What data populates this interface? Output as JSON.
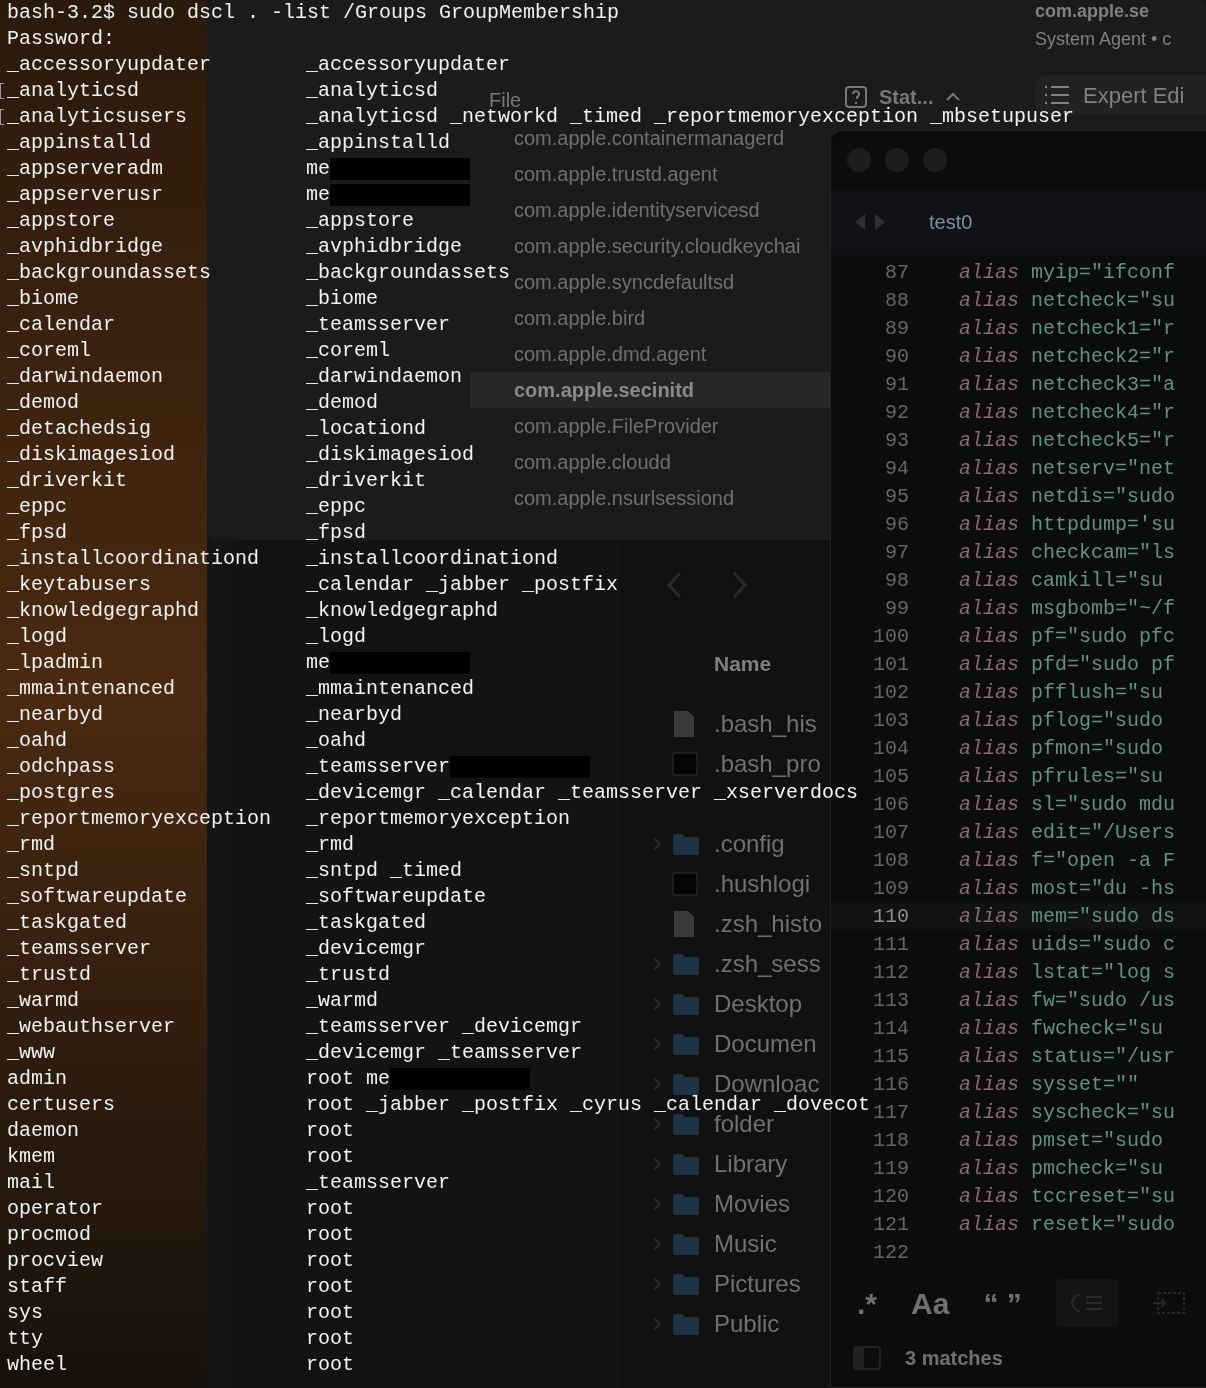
{
  "terminal": {
    "command": "bash-3.2$ sudo dscl . -list /Groups GroupMembership",
    "prompt": "Password:",
    "rows": [
      {
        "group": "_accessoryupdater",
        "members": "_accessoryupdater",
        "marked": false,
        "redacted": false
      },
      {
        "group": "_analyticsd",
        "members": "_analyticsd",
        "marked": true,
        "redacted": false
      },
      {
        "group": "_analyticsusers",
        "members": "_analyticsd _networkd _timed _reportmemoryexception _mbsetupuser",
        "marked": true,
        "redacted": false
      },
      {
        "group": "_appinstalld",
        "members": "_appinstalld",
        "marked": false,
        "redacted": false
      },
      {
        "group": "_appserveradm",
        "members": "me",
        "marked": false,
        "redacted": true
      },
      {
        "group": "_appserverusr",
        "members": "me",
        "marked": false,
        "redacted": true
      },
      {
        "group": "_appstore",
        "members": "_appstore",
        "marked": false,
        "redacted": false
      },
      {
        "group": "_avphidbridge",
        "members": "_avphidbridge",
        "marked": false,
        "redacted": false
      },
      {
        "group": "_backgroundassets",
        "members": "_backgroundassets",
        "marked": false,
        "redacted": false
      },
      {
        "group": "_biome",
        "members": "_biome",
        "marked": false,
        "redacted": false
      },
      {
        "group": "_calendar",
        "members": "_teamsserver",
        "marked": false,
        "redacted": false
      },
      {
        "group": "_coreml",
        "members": "_coreml",
        "marked": false,
        "redacted": false
      },
      {
        "group": "_darwindaemon",
        "members": "_darwindaemon",
        "marked": false,
        "redacted": false
      },
      {
        "group": "_demod",
        "members": "_demod",
        "marked": false,
        "redacted": false
      },
      {
        "group": "_detachedsig",
        "members": "_locationd",
        "marked": false,
        "redacted": false
      },
      {
        "group": "_diskimagesiod",
        "members": "_diskimagesiod",
        "marked": false,
        "redacted": false
      },
      {
        "group": "_driverkit",
        "members": "_driverkit",
        "marked": false,
        "redacted": false
      },
      {
        "group": "_eppc",
        "members": "_eppc",
        "marked": false,
        "redacted": false
      },
      {
        "group": "_fpsd",
        "members": "_fpsd",
        "marked": false,
        "redacted": false
      },
      {
        "group": "_installcoordinationd",
        "members": "_installcoordinationd",
        "marked": false,
        "redacted": false
      },
      {
        "group": "_keytabusers",
        "members": "_calendar _jabber _postfix",
        "marked": false,
        "redacted": false
      },
      {
        "group": "_knowledgegraphd",
        "members": "_knowledgegraphd",
        "marked": false,
        "redacted": false
      },
      {
        "group": "_logd",
        "members": "_logd",
        "marked": false,
        "redacted": false
      },
      {
        "group": "_lpadmin",
        "members": "me",
        "marked": false,
        "redacted": true
      },
      {
        "group": "_mmaintenanced",
        "members": "_mmaintenanced",
        "marked": false,
        "redacted": false
      },
      {
        "group": "_nearbyd",
        "members": "_nearbyd",
        "marked": false,
        "redacted": false
      },
      {
        "group": "_oahd",
        "members": "_oahd",
        "marked": false,
        "redacted": false
      },
      {
        "group": "_odchpass",
        "members": "_teamsserver",
        "marked": false,
        "redacted": true
      },
      {
        "group": "_postgres",
        "members": "_devicemgr _calendar _teamsserver _xserverdocs",
        "marked": false,
        "redacted": false
      },
      {
        "group": "_reportmemoryexception",
        "members": "_reportmemoryexception",
        "marked": false,
        "redacted": false
      },
      {
        "group": "_rmd",
        "members": "_rmd",
        "marked": false,
        "redacted": false
      },
      {
        "group": "_sntpd",
        "members": "_sntpd _timed",
        "marked": false,
        "redacted": false
      },
      {
        "group": "_softwareupdate",
        "members": "_softwareupdate",
        "marked": false,
        "redacted": false
      },
      {
        "group": "_taskgated",
        "members": "_taskgated",
        "marked": false,
        "redacted": false
      },
      {
        "group": "_teamsserver",
        "members": "_devicemgr",
        "marked": false,
        "redacted": false
      },
      {
        "group": "_trustd",
        "members": "_trustd",
        "marked": false,
        "redacted": false
      },
      {
        "group": "_warmd",
        "members": "_warmd",
        "marked": false,
        "redacted": false
      },
      {
        "group": "_webauthserver",
        "members": "_teamsserver _devicemgr",
        "marked": false,
        "redacted": false
      },
      {
        "group": "_www",
        "members": "_devicemgr _teamsserver",
        "marked": false,
        "redacted": false
      },
      {
        "group": "admin",
        "members": "root me",
        "marked": false,
        "redacted": true
      },
      {
        "group": "certusers",
        "members": "root _jabber _postfix _cyrus _calendar _dovecot",
        "marked": false,
        "redacted": false
      },
      {
        "group": "daemon",
        "members": "root",
        "marked": false,
        "redacted": false
      },
      {
        "group": "kmem",
        "members": "root",
        "marked": false,
        "redacted": false
      },
      {
        "group": "mail",
        "members": "_teamsserver",
        "marked": false,
        "redacted": false
      },
      {
        "group": "operator",
        "members": "root",
        "marked": false,
        "redacted": false
      },
      {
        "group": "procmod",
        "members": "root",
        "marked": false,
        "redacted": false
      },
      {
        "group": "procview",
        "members": "root",
        "marked": false,
        "redacted": false
      },
      {
        "group": "staff",
        "members": "root",
        "marked": false,
        "redacted": false
      },
      {
        "group": "sys",
        "members": "root",
        "marked": false,
        "redacted": false
      },
      {
        "group": "tty",
        "members": "root",
        "marked": false,
        "redacted": false
      },
      {
        "group": "wheel",
        "members": "root",
        "marked": false,
        "redacted": false
      }
    ]
  },
  "jobs_window": {
    "file_header": "File",
    "status_header": "Stat...",
    "jobs": [
      {
        "label": "com.apple.containermanagerd",
        "selected": false
      },
      {
        "label": "com.apple.trustd.agent",
        "selected": false
      },
      {
        "label": "com.apple.identityservicesd",
        "selected": false
      },
      {
        "label": "com.apple.security.cloudkeychai",
        "selected": false
      },
      {
        "label": "com.apple.syncdefaultsd",
        "selected": false
      },
      {
        "label": "com.apple.bird",
        "selected": false
      },
      {
        "label": "com.apple.dmd.agent",
        "selected": false
      },
      {
        "label": "com.apple.secinitd",
        "selected": true
      },
      {
        "label": "com.apple.FileProvider",
        "selected": false
      },
      {
        "label": "com.apple.cloudd",
        "selected": false
      },
      {
        "label": "com.apple.nsurlsessiond",
        "selected": false
      }
    ],
    "inspector": {
      "title": "com.apple.se",
      "subtitle": "System Agent • c",
      "expert_button": "Expert Edi"
    }
  },
  "editor": {
    "tab": "test0",
    "lines": [
      {
        "n": "87",
        "kw": "alias",
        "code": "myip=\"ifconf",
        "current": false
      },
      {
        "n": "88",
        "kw": "alias",
        "code": "netcheck=\"su",
        "current": false
      },
      {
        "n": "89",
        "kw": "alias",
        "code": "netcheck1=\"r",
        "current": false
      },
      {
        "n": "90",
        "kw": "alias",
        "code": "netcheck2=\"r",
        "current": false
      },
      {
        "n": "91",
        "kw": "alias",
        "code": "netcheck3=\"a",
        "current": false
      },
      {
        "n": "92",
        "kw": "alias",
        "code": "netcheck4=\"r",
        "current": false
      },
      {
        "n": "93",
        "kw": "alias",
        "code": "netcheck5=\"r",
        "current": false
      },
      {
        "n": "94",
        "kw": "alias",
        "code": "netserv=\"net",
        "current": false
      },
      {
        "n": "95",
        "kw": "alias",
        "code": "netdis=\"sudo",
        "current": false
      },
      {
        "n": "96",
        "kw": "alias",
        "code": "httpdump='su",
        "current": false
      },
      {
        "n": "97",
        "kw": "alias",
        "code": "checkcam=\"ls",
        "current": false
      },
      {
        "n": "98",
        "kw": "alias",
        "code": "camkill=\"su",
        "current": false
      },
      {
        "n": "99",
        "kw": "alias",
        "code": "msgbomb=\"~/f",
        "current": false
      },
      {
        "n": "100",
        "kw": "alias",
        "code": "pf=\"sudo pfc",
        "current": false
      },
      {
        "n": "101",
        "kw": "alias",
        "code": "pfd=\"sudo pf",
        "current": false
      },
      {
        "n": "102",
        "kw": "alias",
        "code": "pfflush=\"su",
        "current": false
      },
      {
        "n": "103",
        "kw": "alias",
        "code": "pflog=\"sudo",
        "current": false
      },
      {
        "n": "104",
        "kw": "alias",
        "code": "pfmon=\"sudo",
        "current": false
      },
      {
        "n": "105",
        "kw": "alias",
        "code": "pfrules=\"su",
        "current": false
      },
      {
        "n": "106",
        "kw": "alias",
        "code": "sl=\"sudo mdu",
        "current": false
      },
      {
        "n": "107",
        "kw": "alias",
        "code": "edit=\"/Users",
        "current": false
      },
      {
        "n": "108",
        "kw": "alias",
        "code": "f=\"open -a F",
        "current": false
      },
      {
        "n": "109",
        "kw": "alias",
        "code": "most=\"du -hs",
        "current": false
      },
      {
        "n": "110",
        "kw": "alias",
        "code": "mem=\"sudo ds",
        "current": true
      },
      {
        "n": "111",
        "kw": "alias",
        "code": "uids=\"sudo c",
        "current": false
      },
      {
        "n": "112",
        "kw": "alias",
        "code": "lstat=\"log s",
        "current": false
      },
      {
        "n": "113",
        "kw": "alias",
        "code": "fw=\"sudo /us",
        "current": false
      },
      {
        "n": "114",
        "kw": "alias",
        "code": "fwcheck=\"su",
        "current": false
      },
      {
        "n": "115",
        "kw": "alias",
        "code": "status=\"/usr",
        "current": false
      },
      {
        "n": "116",
        "kw": "alias",
        "code": "sysset=\"\"",
        "current": false
      },
      {
        "n": "117",
        "kw": "alias",
        "code": "syscheck=\"su",
        "current": false
      },
      {
        "n": "118",
        "kw": "alias",
        "code": "pmset=\"sudo",
        "current": false
      },
      {
        "n": "119",
        "kw": "alias",
        "code": "pmcheck=\"su",
        "current": false
      },
      {
        "n": "120",
        "kw": "alias",
        "code": "tccreset=\"su",
        "current": false
      },
      {
        "n": "121",
        "kw": "alias",
        "code": "resetk=\"sudo",
        "current": false
      },
      {
        "n": "122",
        "current": false
      }
    ],
    "search_options": [
      ".*",
      "Aa",
      "“ ”"
    ],
    "matches": "3 matches"
  },
  "finder": {
    "name_header": "Name",
    "items": [
      {
        "name": ".bash_his",
        "kind": "file",
        "expandable": false
      },
      {
        "name": ".bash_pro",
        "kind": "exec",
        "expandable": false
      },
      {
        "kind": "covered",
        "expandable": false
      },
      {
        "name": ".config",
        "kind": "folder",
        "expandable": true
      },
      {
        "name": ".hushlogi",
        "kind": "exec",
        "expandable": false
      },
      {
        "name": ".zsh_histo",
        "kind": "file",
        "expandable": false
      },
      {
        "name": ".zsh_sess",
        "kind": "folder",
        "expandable": true
      },
      {
        "name": "Desktop",
        "kind": "folder",
        "expandable": true
      },
      {
        "name": "Documen",
        "kind": "folder",
        "expandable": true
      },
      {
        "name": "Downloac",
        "kind": "folder",
        "expandable": true
      },
      {
        "name": "folder",
        "kind": "folder",
        "expandable": true
      },
      {
        "name": "Library",
        "kind": "folder",
        "expandable": true
      },
      {
        "name": "Movies",
        "kind": "folder",
        "expandable": true
      },
      {
        "name": "Music",
        "kind": "folder",
        "expandable": true
      },
      {
        "name": "Pictures",
        "kind": "folder",
        "expandable": true
      },
      {
        "name": "Public",
        "kind": "folder",
        "expandable": true
      }
    ]
  }
}
